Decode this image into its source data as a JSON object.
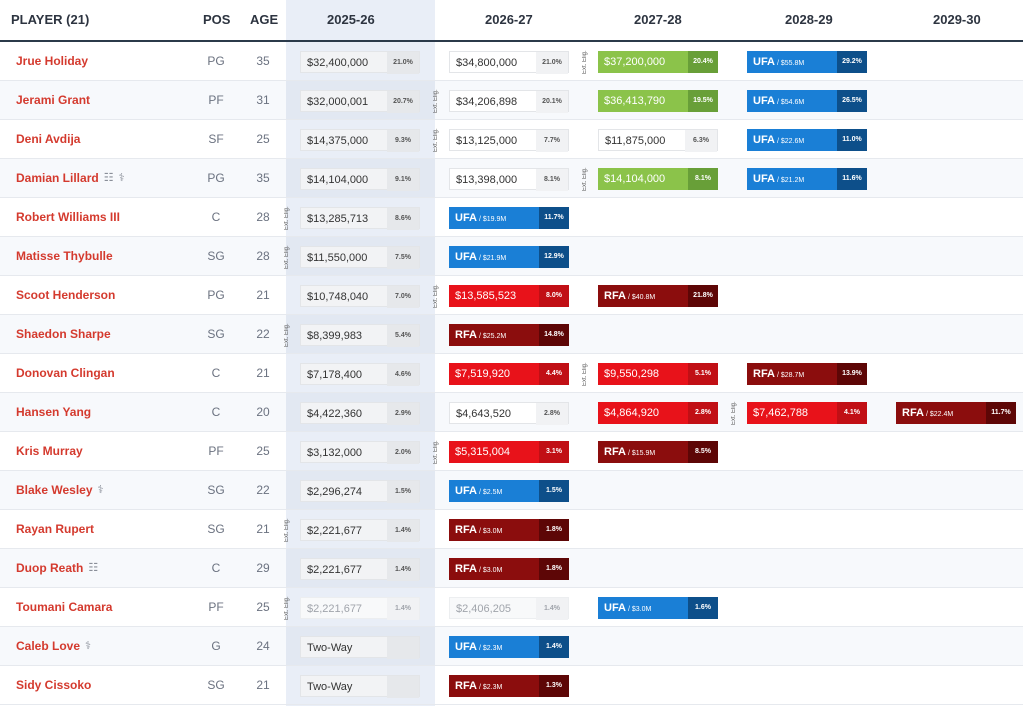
{
  "header": {
    "player": "PLAYER (21)",
    "pos": "POS",
    "age": "AGE",
    "seasons": [
      "2025-26",
      "2026-27",
      "2027-28",
      "2028-29",
      "2029-30"
    ]
  },
  "ext_label": "Ext. Elig.",
  "colors": {
    "player_name": "#d43a2e",
    "team_option": "#8bc34a",
    "rookie_scale": "#e8121a",
    "ufa": "#1a7fd6",
    "rfa": "#8b0d0d"
  },
  "players": [
    {
      "name": "Jrue Holiday",
      "icons": [],
      "pos": "PG",
      "age": "35",
      "cells": [
        {
          "t": "gtd",
          "amt": "$32,400,000",
          "pct": "21.0%"
        },
        {
          "t": "plain",
          "amt": "$34,800,000",
          "pct": "21.0%"
        },
        {
          "t": "team",
          "amt": "$37,200,000",
          "pct": "20.4%",
          "ext": true
        },
        {
          "t": "ufa",
          "kind": "UFA",
          "amt": " / $55.8M",
          "pct": "29.2%"
        },
        null
      ]
    },
    {
      "name": "Jerami Grant",
      "icons": [],
      "pos": "PF",
      "age": "31",
      "cells": [
        {
          "t": "gtd",
          "amt": "$32,000,001",
          "pct": "20.7%"
        },
        {
          "t": "plain",
          "amt": "$34,206,898",
          "pct": "20.1%",
          "ext": true
        },
        {
          "t": "team",
          "amt": "$36,413,790",
          "pct": "19.5%"
        },
        {
          "t": "ufa",
          "kind": "UFA",
          "amt": " / $54.6M",
          "pct": "26.5%"
        },
        null
      ]
    },
    {
      "name": "Deni Avdija",
      "icons": [],
      "pos": "SF",
      "age": "25",
      "cells": [
        {
          "t": "gtd",
          "amt": "$14,375,000",
          "pct": "9.3%"
        },
        {
          "t": "plain",
          "amt": "$13,125,000",
          "pct": "7.7%",
          "ext": true
        },
        {
          "t": "plain",
          "amt": "$11,875,000",
          "pct": "6.3%"
        },
        {
          "t": "ufa",
          "kind": "UFA",
          "amt": " / $22.6M",
          "pct": "11.0%"
        },
        null
      ]
    },
    {
      "name": "Damian Lillard",
      "icons": [
        "document-icon",
        "medical-icon"
      ],
      "pos": "PG",
      "age": "35",
      "cells": [
        {
          "t": "gtd",
          "amt": "$14,104,000",
          "pct": "9.1%"
        },
        {
          "t": "plain",
          "amt": "$13,398,000",
          "pct": "8.1%"
        },
        {
          "t": "team",
          "amt": "$14,104,000",
          "pct": "8.1%",
          "ext": true
        },
        {
          "t": "ufa",
          "kind": "UFA",
          "amt": " / $21.2M",
          "pct": "11.6%"
        },
        null
      ]
    },
    {
      "name": "Robert Williams III",
      "icons": [],
      "pos": "C",
      "age": "28",
      "cells": [
        {
          "t": "gtd",
          "amt": "$13,285,713",
          "pct": "8.6%",
          "ext": true
        },
        {
          "t": "ufa",
          "kind": "UFA",
          "amt": " / $19.9M",
          "pct": "11.7%"
        },
        null,
        null,
        null
      ]
    },
    {
      "name": "Matisse Thybulle",
      "icons": [],
      "pos": "SG",
      "age": "28",
      "cells": [
        {
          "t": "gtd",
          "amt": "$11,550,000",
          "pct": "7.5%",
          "ext": true
        },
        {
          "t": "ufa",
          "kind": "UFA",
          "amt": " / $21.9M",
          "pct": "12.9%"
        },
        null,
        null,
        null
      ]
    },
    {
      "name": "Scoot Henderson",
      "icons": [],
      "pos": "PG",
      "age": "21",
      "cells": [
        {
          "t": "gtd",
          "amt": "$10,748,040",
          "pct": "7.0%"
        },
        {
          "t": "rookie",
          "amt": "$13,585,523",
          "pct": "8.0%",
          "ext": true
        },
        {
          "t": "rfa",
          "kind": "RFA",
          "amt": " / $40.8M",
          "pct": "21.8%"
        },
        null,
        null
      ]
    },
    {
      "name": "Shaedon Sharpe",
      "icons": [],
      "pos": "SG",
      "age": "22",
      "cells": [
        {
          "t": "gtd",
          "amt": "$8,399,983",
          "pct": "5.4%",
          "ext": true
        },
        {
          "t": "rfa",
          "kind": "RFA",
          "amt": " / $25.2M",
          "pct": "14.8%"
        },
        null,
        null,
        null
      ]
    },
    {
      "name": "Donovan Clingan",
      "icons": [],
      "pos": "C",
      "age": "21",
      "cells": [
        {
          "t": "gtd",
          "amt": "$7,178,400",
          "pct": "4.6%"
        },
        {
          "t": "rookie",
          "amt": "$7,519,920",
          "pct": "4.4%"
        },
        {
          "t": "rookie",
          "amt": "$9,550,298",
          "pct": "5.1%",
          "ext": true
        },
        {
          "t": "rfa",
          "kind": "RFA",
          "amt": " / $28.7M",
          "pct": "13.9%"
        },
        null
      ]
    },
    {
      "name": "Hansen Yang",
      "icons": [],
      "pos": "C",
      "age": "20",
      "cells": [
        {
          "t": "gtd",
          "amt": "$4,422,360",
          "pct": "2.9%"
        },
        {
          "t": "plain",
          "amt": "$4,643,520",
          "pct": "2.8%"
        },
        {
          "t": "rookie",
          "amt": "$4,864,920",
          "pct": "2.8%"
        },
        {
          "t": "rookie",
          "amt": "$7,462,788",
          "pct": "4.1%",
          "ext": true
        },
        {
          "t": "rfa",
          "kind": "RFA",
          "amt": " / $22.4M",
          "pct": "11.7%"
        }
      ]
    },
    {
      "name": "Kris Murray",
      "icons": [],
      "pos": "PF",
      "age": "25",
      "cells": [
        {
          "t": "gtd",
          "amt": "$3,132,000",
          "pct": "2.0%"
        },
        {
          "t": "rookie",
          "amt": "$5,315,004",
          "pct": "3.1%",
          "ext": true
        },
        {
          "t": "rfa",
          "kind": "RFA",
          "amt": " / $15.9M",
          "pct": "8.5%"
        },
        null,
        null
      ]
    },
    {
      "name": "Blake Wesley",
      "icons": [
        "medical-icon"
      ],
      "pos": "SG",
      "age": "22",
      "cells": [
        {
          "t": "gtd",
          "amt": "$2,296,274",
          "pct": "1.5%"
        },
        {
          "t": "ufa",
          "kind": "UFA",
          "amt": " / $2.5M",
          "pct": "1.5%"
        },
        null,
        null,
        null
      ]
    },
    {
      "name": "Rayan Rupert",
      "icons": [],
      "pos": "SG",
      "age": "21",
      "cells": [
        {
          "t": "gtd",
          "amt": "$2,221,677",
          "pct": "1.4%",
          "ext": true
        },
        {
          "t": "rfa",
          "kind": "RFA",
          "amt": " / $3.0M",
          "pct": "1.8%"
        },
        null,
        null,
        null
      ]
    },
    {
      "name": "Duop Reath",
      "icons": [
        "document-icon"
      ],
      "pos": "C",
      "age": "29",
      "cells": [
        {
          "t": "gtd",
          "amt": "$2,221,677",
          "pct": "1.4%"
        },
        {
          "t": "rfa",
          "kind": "RFA",
          "amt": " / $3.0M",
          "pct": "1.8%"
        },
        null,
        null,
        null
      ]
    },
    {
      "name": "Toumani Camara",
      "icons": [],
      "pos": "PF",
      "age": "25",
      "cells": [
        {
          "t": "faded",
          "amt": "$2,221,677",
          "pct": "1.4%",
          "ext": true
        },
        {
          "t": "faded",
          "amt": "$2,406,205",
          "pct": "1.4%"
        },
        {
          "t": "ufa",
          "kind": "UFA",
          "amt": " / $3.0M",
          "pct": "1.6%"
        },
        null,
        null
      ]
    },
    {
      "name": "Caleb Love",
      "icons": [
        "medical-icon"
      ],
      "pos": "G",
      "age": "24",
      "cells": [
        {
          "t": "twoway",
          "amt": "Two-Way",
          "pct": ""
        },
        {
          "t": "ufa",
          "kind": "UFA",
          "amt": " / $2.3M",
          "pct": "1.4%"
        },
        null,
        null,
        null
      ]
    },
    {
      "name": "Sidy Cissoko",
      "icons": [],
      "pos": "SG",
      "age": "21",
      "cells": [
        {
          "t": "twoway",
          "amt": "Two-Way",
          "pct": ""
        },
        {
          "t": "rfa",
          "kind": "RFA",
          "amt": " / $2.3M",
          "pct": "1.3%"
        },
        null,
        null,
        null
      ]
    }
  ]
}
